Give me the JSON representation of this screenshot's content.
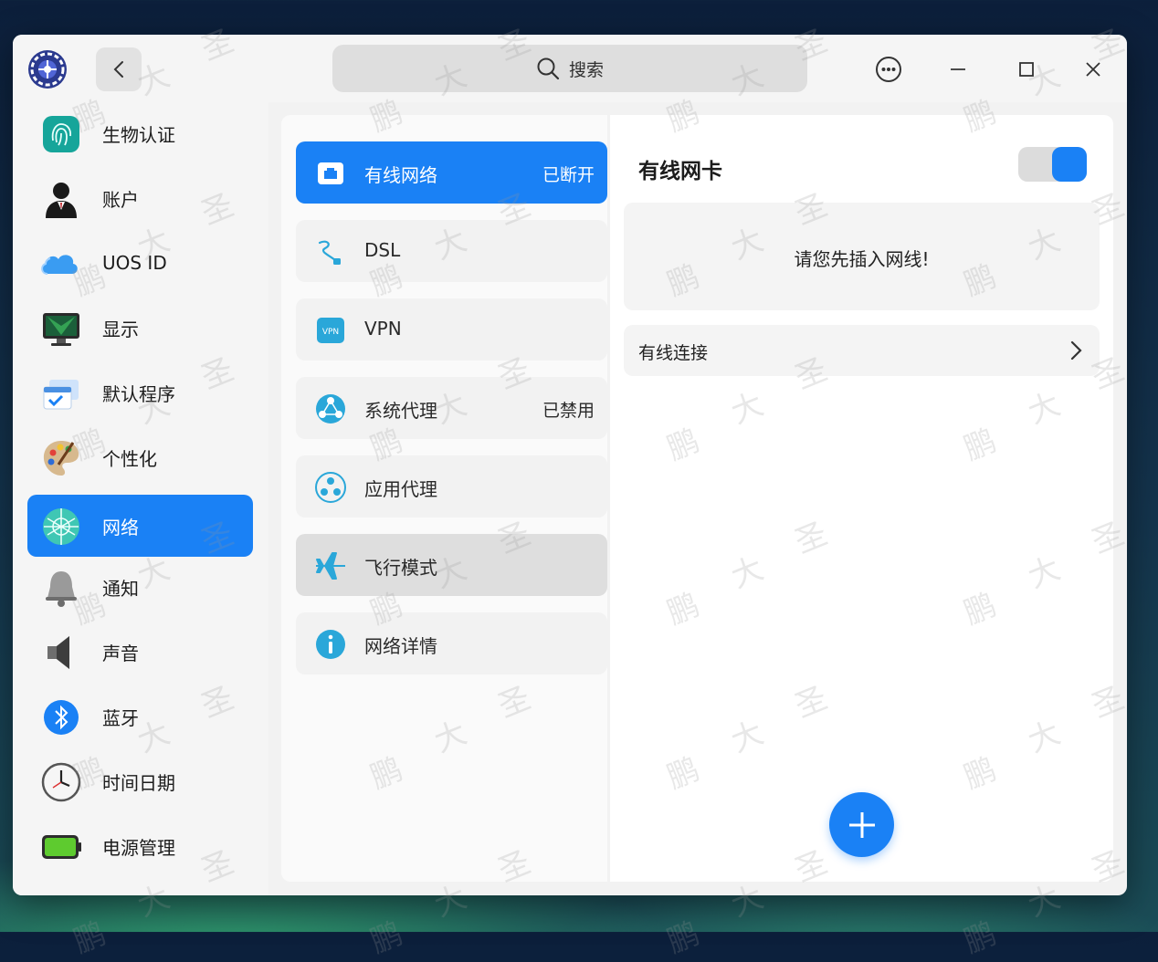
{
  "search": {
    "placeholder": "搜索"
  },
  "sidebar": {
    "items": [
      {
        "label": "生物认证",
        "icon": "fingerprint-icon"
      },
      {
        "label": "账户",
        "icon": "account-icon"
      },
      {
        "label": "UOS ID",
        "icon": "cloud-icon"
      },
      {
        "label": "显示",
        "icon": "display-icon"
      },
      {
        "label": "默认程序",
        "icon": "default-apps-icon"
      },
      {
        "label": "个性化",
        "icon": "palette-icon"
      },
      {
        "label": "网络",
        "icon": "network-icon",
        "active": true
      },
      {
        "label": "通知",
        "icon": "bell-icon"
      },
      {
        "label": "声音",
        "icon": "speaker-icon"
      },
      {
        "label": "蓝牙",
        "icon": "bluetooth-icon"
      },
      {
        "label": "时间日期",
        "icon": "clock-icon"
      },
      {
        "label": "电源管理",
        "icon": "battery-icon"
      }
    ]
  },
  "network": {
    "items": [
      {
        "label": "有线网络",
        "status": "已断开",
        "icon": "wired-network-icon",
        "active": true
      },
      {
        "label": "DSL",
        "status": "",
        "icon": "dsl-icon"
      },
      {
        "label": "VPN",
        "status": "",
        "icon": "vpn-icon"
      },
      {
        "label": "系统代理",
        "status": "已禁用",
        "icon": "system-proxy-icon"
      },
      {
        "label": "应用代理",
        "status": "",
        "icon": "app-proxy-icon"
      },
      {
        "label": "飞行模式",
        "status": "",
        "icon": "airplane-icon",
        "hover": true
      },
      {
        "label": "网络详情",
        "status": "",
        "icon": "info-icon"
      }
    ]
  },
  "detail": {
    "title": "有线网卡",
    "toggle_on": true,
    "notice": "请您先插入网线!",
    "wired_connection_label": "有线连接"
  },
  "watermark": {
    "chars": [
      "鹏",
      "大",
      "圣"
    ]
  },
  "colors": {
    "accent": "#1a81f5",
    "window_bg": "#f2f2f2"
  }
}
